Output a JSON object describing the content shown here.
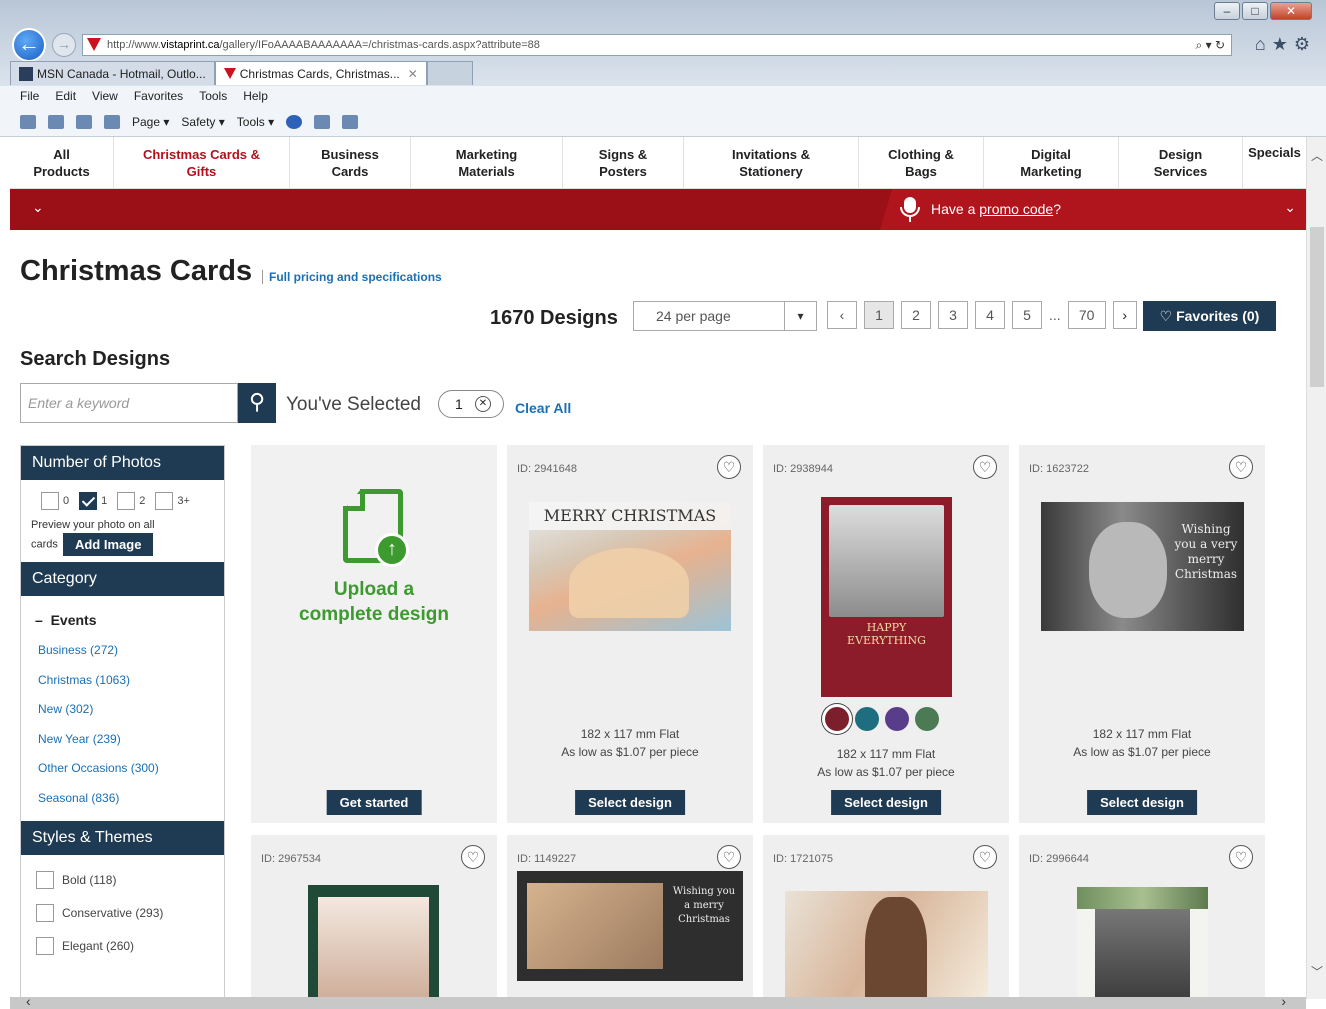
{
  "browser": {
    "url_prefix": "http://www.",
    "url_domain": "vistaprint.ca",
    "url_rest": "/gallery/IFoAAAABAAAAAAA=/christmas-cards.aspx?attribute=88",
    "tabs": [
      {
        "label": "MSN Canada - Hotmail, Outlo..."
      },
      {
        "label": "Christmas Cards, Christmas..."
      }
    ],
    "menu": [
      "File",
      "Edit",
      "View",
      "Favorites",
      "Tools",
      "Help"
    ],
    "commands": {
      "page": "Page ▾",
      "safety": "Safety ▾",
      "tools": "Tools ▾"
    }
  },
  "nav": [
    {
      "label": "All\nProducts"
    },
    {
      "label": "Christmas Cards &\nGifts"
    },
    {
      "label": "Business\nCards"
    },
    {
      "label": "Marketing\nMaterials"
    },
    {
      "label": "Signs &\nPosters"
    },
    {
      "label": "Invitations &\nStationery"
    },
    {
      "label": "Clothing &\nBags"
    },
    {
      "label": "Digital\nMarketing"
    },
    {
      "label": "Design\nServices"
    },
    {
      "label": "Specials"
    }
  ],
  "promo": {
    "pre": "Have a ",
    "link": "promo code",
    "post": "?"
  },
  "page": {
    "title": "Christmas Cards",
    "pricing_link": "Full pricing and specifications",
    "designs_count": "1670 Designs",
    "per_page": "24 per page",
    "pages": [
      "1",
      "2",
      "3",
      "4",
      "5",
      "70"
    ],
    "ellipsis": "...",
    "favorites": "♡ Favorites (0)"
  },
  "search": {
    "title": "Search Designs",
    "placeholder": "Enter a keyword",
    "selected_label": "You've Selected",
    "selected_count": "1",
    "clear_all": "Clear All"
  },
  "filters": {
    "photos_title": "Number of Photos",
    "photo_options": [
      {
        "label": "0",
        "checked": false
      },
      {
        "label": "1",
        "checked": true
      },
      {
        "label": "2",
        "checked": false
      },
      {
        "label": "3+",
        "checked": false
      }
    ],
    "preview_text_1": "Preview your photo on all",
    "preview_text_2": "cards",
    "add_image": "Add Image",
    "category_title": "Category",
    "events_label": "Events",
    "categories": [
      "Business (272)",
      "Christmas (1063)",
      "New (302)",
      "New Year (239)",
      "Other Occasions (300)",
      "Seasonal (836)"
    ],
    "styles_title": "Styles & Themes",
    "styles": [
      "Bold (118)",
      "Conservative (293)",
      "Elegant (260)"
    ]
  },
  "cards": {
    "upload": {
      "text_1": "Upload a",
      "text_2": "complete design",
      "button": "Get started"
    },
    "items": [
      {
        "id": "ID: 2941648",
        "size": "182 x 117 mm Flat",
        "price": "As low as $1.07 per piece",
        "button": "Select design",
        "caption": "MERRY CHRISTMAS"
      },
      {
        "id": "ID: 2938944",
        "size": "182 x 117 mm Flat",
        "price": "As low as $1.07 per piece",
        "button": "Select design",
        "caption_1": "HAPPY",
        "caption_2": "EVERYTHING"
      },
      {
        "id": "ID: 1623722",
        "size": "182 x 117 mm Flat",
        "price": "As low as $1.07 per piece",
        "button": "Select design",
        "caption": "Wishing you a very merry Christmas"
      }
    ],
    "row2": [
      {
        "id": "ID: 2967534"
      },
      {
        "id": "ID: 1149227"
      },
      {
        "id": "ID: 1721075"
      },
      {
        "id": "ID: 2996644"
      }
    ],
    "card5_caption": "Wishing you a merry Christmas"
  },
  "colors": {
    "brand_red": "#9b0f17",
    "navy": "#1f3b53",
    "link_blue": "#1a6fb5",
    "upload_green": "#3c9a2f",
    "swatches": [
      "#7a1f2b",
      "#1e6e80",
      "#5a3d8a",
      "#4b7a55"
    ]
  }
}
